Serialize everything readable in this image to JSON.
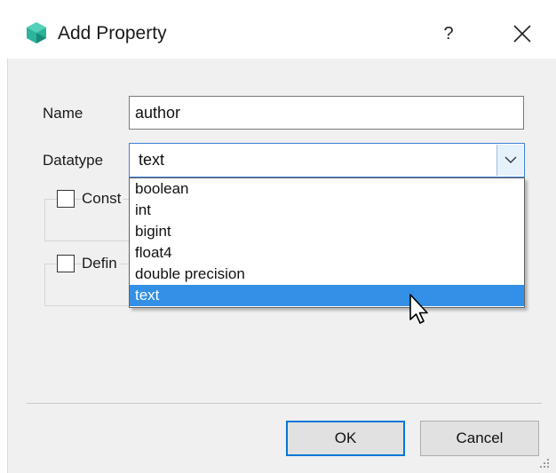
{
  "window": {
    "title": "Add Property",
    "help_label": "?",
    "close_label": "✕"
  },
  "form": {
    "name_label": "Name",
    "name_value": "author",
    "datatype_label": "Datatype",
    "datatype_value": "text",
    "checkbox1_label": "Const",
    "checkbox2_label": "Defin"
  },
  "dropdown": {
    "options": [
      "boolean",
      "int",
      "bigint",
      "float4",
      "double precision",
      "text"
    ],
    "selected": "text"
  },
  "buttons": {
    "ok_label": "OK",
    "cancel_label": "Cancel"
  },
  "colors": {
    "accent": "#3390e6",
    "focus_border": "#0078d7",
    "app_icon": "#2bb39b"
  },
  "icons": {
    "app": "app-logo-icon",
    "combo": "chevron-down-icon",
    "cursor": "mouse-pointer-icon"
  }
}
